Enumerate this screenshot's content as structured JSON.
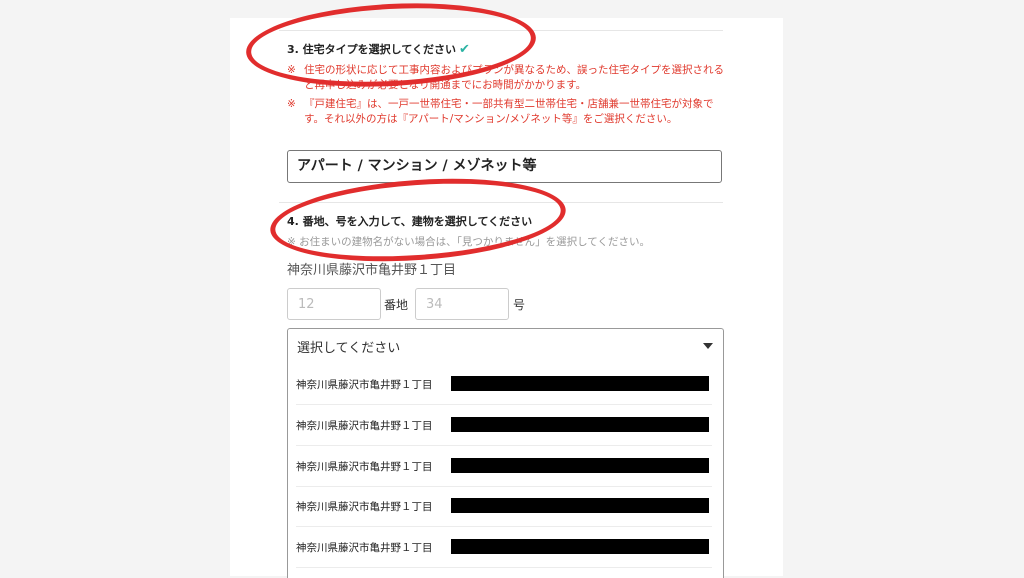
{
  "step3": {
    "title": "3. 住宅タイプを選択してください",
    "check_icon": "✔",
    "note1_mark": "※",
    "note1": "住宅の形状に応じて工事内容およびプランが異なるため、誤った住宅タイプを選択されると再申し込みが必要となり開通までにお時間がかかります。",
    "note2_mark": "※",
    "note2": "『戸建住宅』は、一戸一世帯住宅・一部共有型二世帯住宅・店舗兼一世帯住宅が対象です。それ以外の方は『アパート/マンション/メゾネット等』をご選択ください。",
    "selected": "アパート / マンション / メゾネット等"
  },
  "step4": {
    "title": "4. 番地、号を入力して、建物を選択してください",
    "note": "※ お住まいの建物名がない場合は、「見つかりません」を選択してください。",
    "address": "神奈川県藤沢市亀井野１丁目",
    "banchi_placeholder": "12",
    "banchi_label": "番地",
    "go_placeholder": "34",
    "go_label": "号",
    "dropdown_placeholder": "選択してください",
    "options": [
      {
        "label": "神奈川県藤沢市亀井野１丁目"
      },
      {
        "label": "神奈川県藤沢市亀井野１丁目"
      },
      {
        "label": "神奈川県藤沢市亀井野１丁目"
      },
      {
        "label": "神奈川県藤沢市亀井野１丁目"
      },
      {
        "label": "神奈川県藤沢市亀井野１丁目"
      }
    ]
  },
  "colors": {
    "annotation": "#e12d2d",
    "note": "#e0392d",
    "check": "#2bb3a3"
  }
}
